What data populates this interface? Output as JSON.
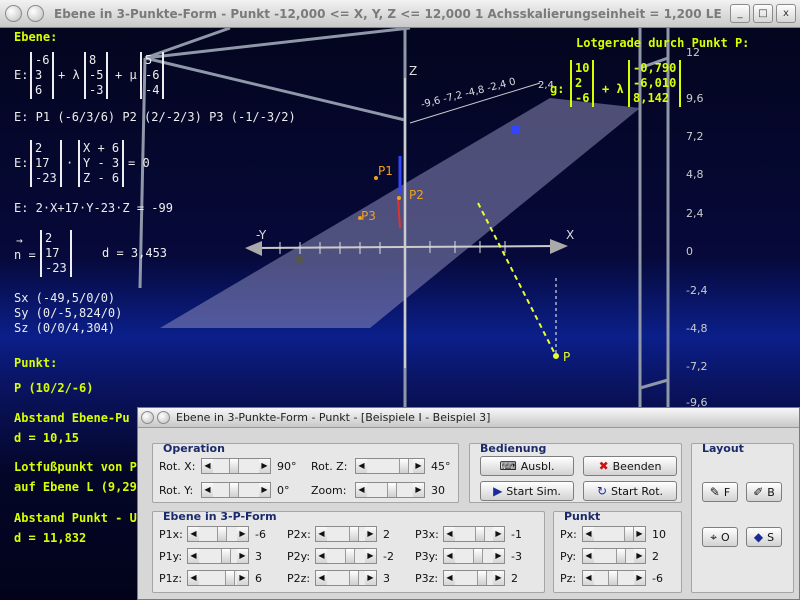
{
  "window": {
    "title": "Ebene in 3-Punkte-Form - Punkt   -12,000 <= X, Y, Z <= 12,000    1 Achsskalierungseinheit = 1,200 LE",
    "buttons": [
      "_",
      "□",
      "x"
    ]
  },
  "info": {
    "heading": "Ebene:",
    "e_prefix": "E:",
    "vec1": "-6\n3\n6",
    "plus_lambda": "+ λ",
    "vec2": "8\n-5\n-3",
    "plus_mu": "+ μ",
    "vec3": "5\n-6\n-4",
    "points_line": "E: P1 (-6/3/6)    P2 (2/-2/3)    P3 (-1/-3/2)",
    "n_vec": "2\n17\n-23",
    "dot": "·",
    "xyz_vec": "X + 6\nY - 3\nZ - 6",
    "eq_zero": "= 0",
    "coord_eq": "E: 2·X+17·Y-23·Z = -99",
    "n_arrow": "→",
    "n_label": "n =",
    "n_vec2": "2\n17\n-23",
    "d1": "d = 3,453",
    "sx": "Sx (-49,5/0/0)",
    "sy": "Sy (0/-5,824/0)",
    "sz": "Sz (0/0/4,304)",
    "punkt_heading": "Punkt:",
    "punkt": "P (10/2/-6)",
    "abstand1": "Abstand Ebene-Pu",
    "d2": "d = 10,15",
    "lotfuss1": "Lotfußpunkt von P",
    "lotfuss2": "auf Ebene L (9,29;",
    "abstand2": "Abstand Punkt - U",
    "d3": "d = 11,832"
  },
  "lotgerade": {
    "heading": "Lotgerade durch Punkt P:",
    "g_label": "g:",
    "vec1": "10\n2\n-6",
    "plus_lambda": "+ λ",
    "vec2": "-0,790\n-6,010\n8,142"
  },
  "plot": {
    "axis_x": "X",
    "axis_y": "-Y",
    "axis_z": "Z",
    "y_ticks": [
      "12",
      "9,6",
      "7,2",
      "4,8",
      "2,4",
      "0",
      "-2,4",
      "-4,8",
      "-7,2",
      "-9,6"
    ],
    "z_tick_labels": [
      "-9,6",
      "-7,2",
      "-4,8",
      "-2,4",
      "0",
      "2,4"
    ],
    "p1": "P1",
    "p2": "P2",
    "p3": "P3",
    "p": "P",
    "colors": {
      "plane": "#8a8ab8",
      "lot": "#e8ff30",
      "points": "#f0a020",
      "axes": "#cccccc"
    }
  },
  "dialog": {
    "title": "Ebene in 3-Punkte-Form - Punkt - [Beispiele I - Beispiel 3]",
    "operation": {
      "label": "Operation",
      "rot_x_label": "Rot. X:",
      "rot_x": "90°",
      "rot_y_label": "Rot. Y:",
      "rot_y": "0°",
      "rot_z_label": "Rot. Z:",
      "rot_z": "45°",
      "zoom_label": "Zoom:",
      "zoom": "30"
    },
    "bedienung": {
      "label": "Bedienung",
      "ausbl": "Ausbl.",
      "beenden": "Beenden",
      "start_sim": "Start Sim.",
      "start_rot": "Start Rot."
    },
    "layout": {
      "label": "Layout",
      "f": "F",
      "b": "B",
      "o": "O",
      "s": "S"
    },
    "ebene": {
      "label": "Ebene in 3-P-Form",
      "p1x_label": "P1x:",
      "p1x": "-6",
      "p1y_label": "P1y:",
      "p1y": "3",
      "p1z_label": "P1z:",
      "p1z": "6",
      "p2x_label": "P2x:",
      "p2x": "2",
      "p2y_label": "P2y:",
      "p2y": "-2",
      "p2z_label": "P2z:",
      "p2z": "3",
      "p3x_label": "P3x:",
      "p3x": "-1",
      "p3y_label": "P3y:",
      "p3y": "-3",
      "p3z_label": "P3z:",
      "p3z": "2"
    },
    "punkt": {
      "label": "Punkt",
      "px_label": "Px:",
      "px": "10",
      "py_label": "Py:",
      "py": "2",
      "pz_label": "Pz:",
      "pz": "-6"
    }
  }
}
